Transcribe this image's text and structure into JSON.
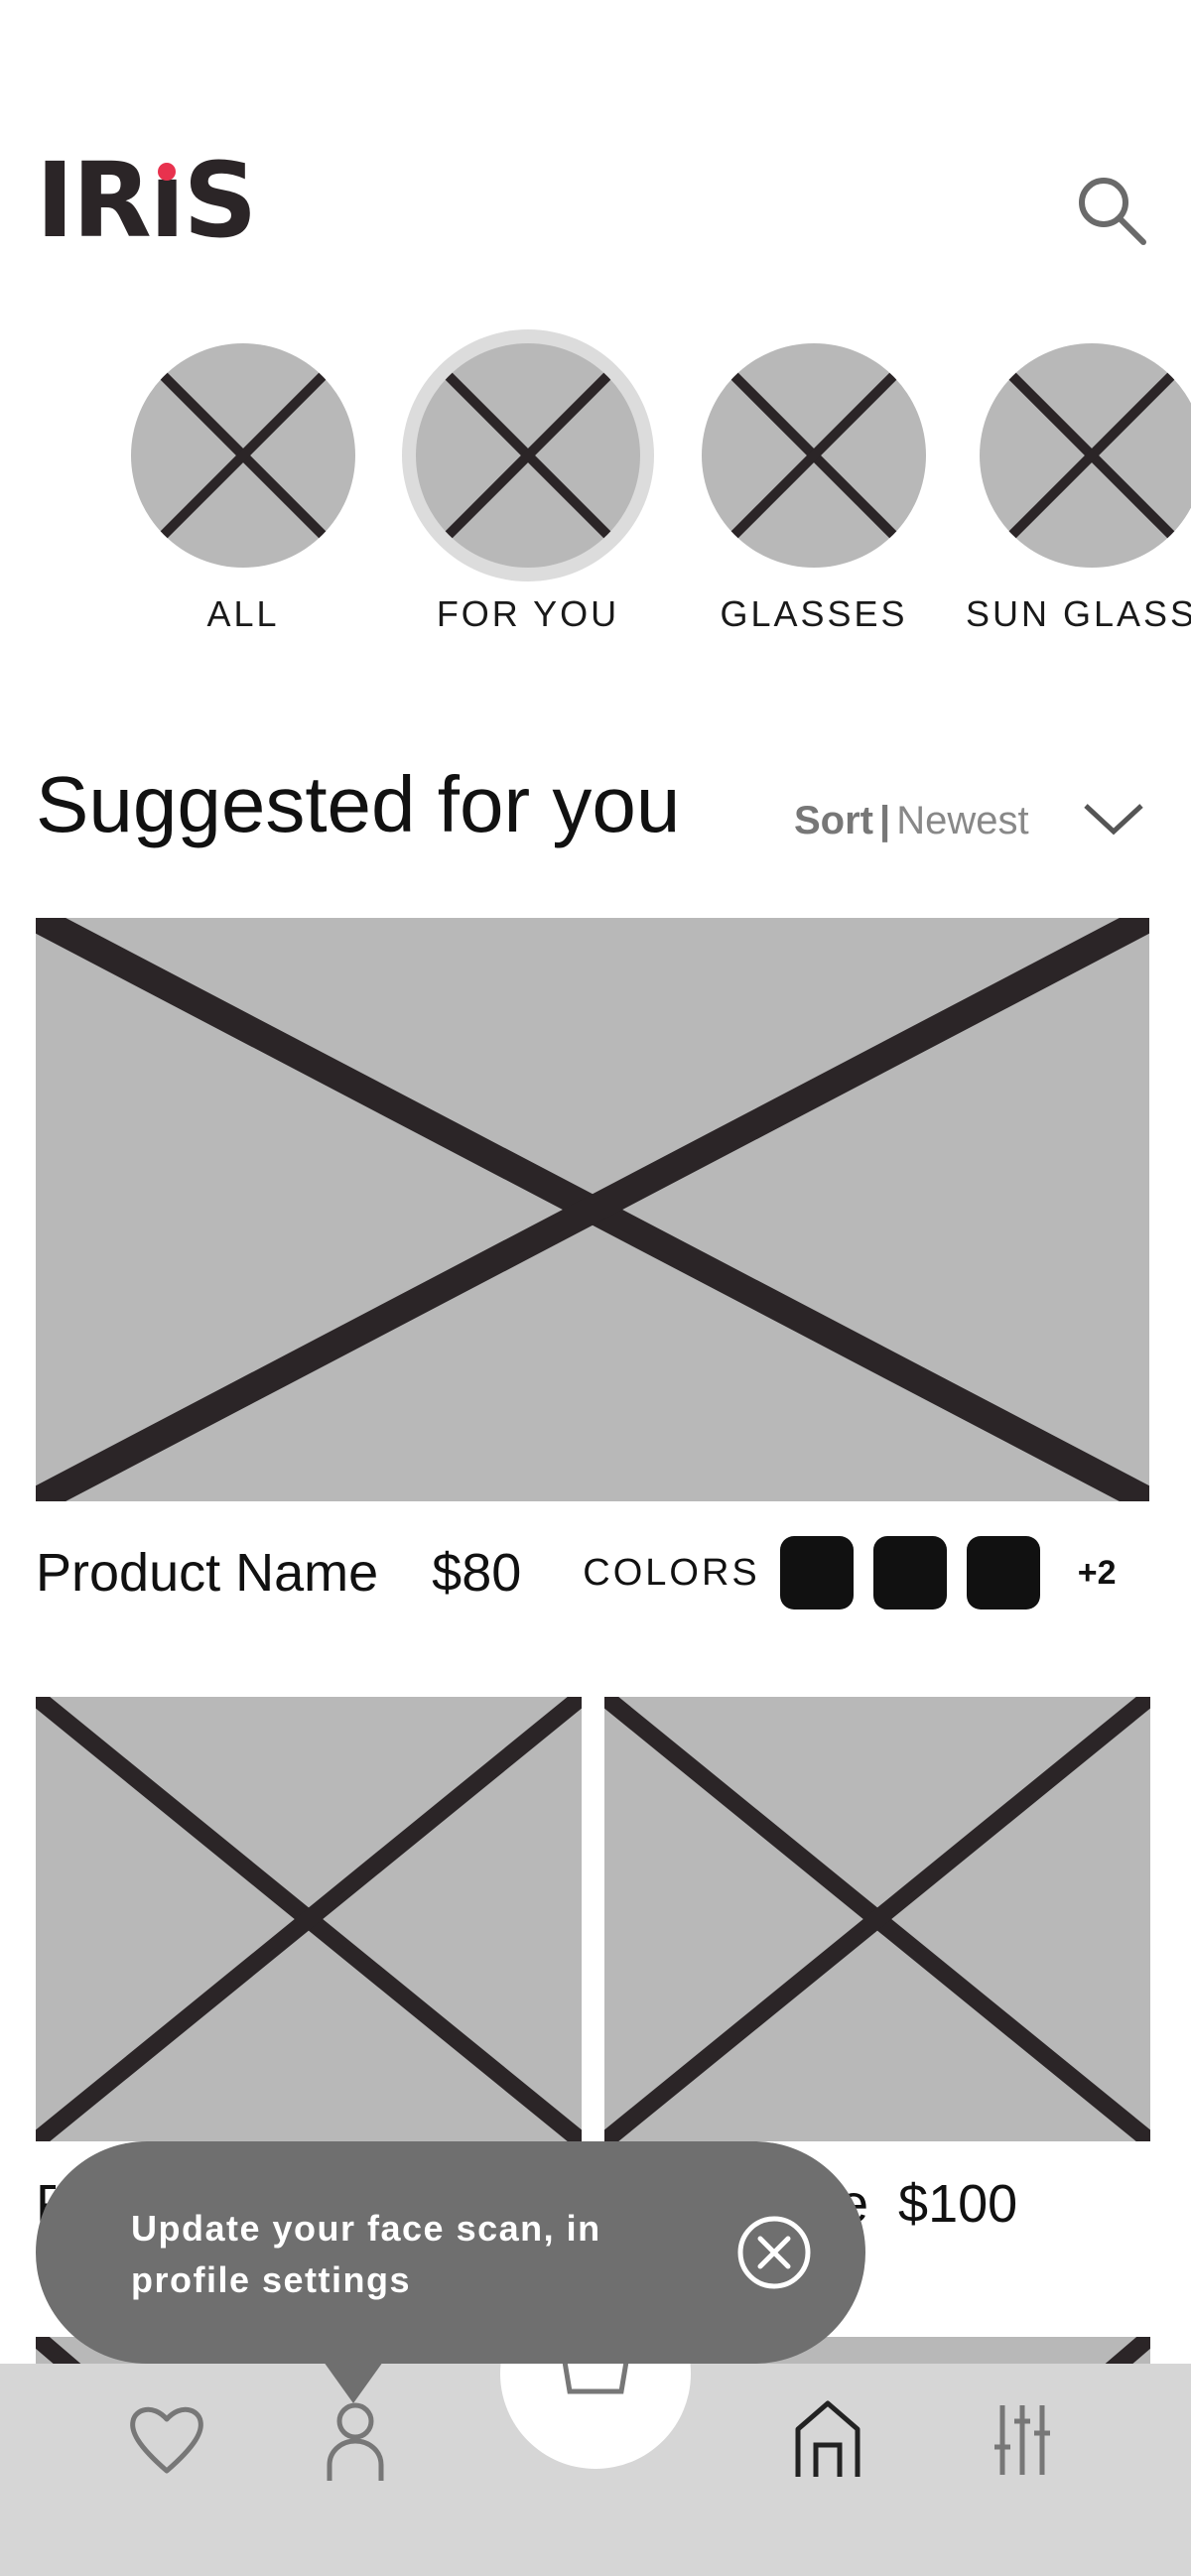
{
  "header": {
    "logo_text": "IRiS",
    "search_icon": "search-icon"
  },
  "categories": [
    {
      "label": "ALL",
      "selected": false
    },
    {
      "label": "FOR YOU",
      "selected": true
    },
    {
      "label": "GLASSES",
      "selected": false
    },
    {
      "label": "SUN GLASS",
      "selected": false
    }
  ],
  "section": {
    "title": "Suggested for you",
    "sort_label": "Sort",
    "sort_divider": "|",
    "sort_value": "Newest"
  },
  "featured_product": {
    "name": "Product Name",
    "price": "$80",
    "colors_label": "COLORS",
    "swatch_colors": [
      "#111111",
      "#111111",
      "#111111"
    ],
    "more_colors": "+2"
  },
  "grid_products": [
    {
      "name": "P",
      "price": ""
    },
    {
      "name": "ame",
      "price": "$100"
    }
  ],
  "toast": {
    "message": "Update your face scan, in profile settings",
    "close_icon": "close-circle-icon"
  },
  "bottom_nav": {
    "items": [
      "heart-icon",
      "profile-icon",
      "cart-icon",
      "home-icon",
      "filter-icon"
    ]
  },
  "colors": {
    "accent": "#e8324e",
    "placeholder": "#b8b8b8",
    "toast_bg": "#6f6f6f",
    "nav_bg": "#d6d6d6"
  }
}
